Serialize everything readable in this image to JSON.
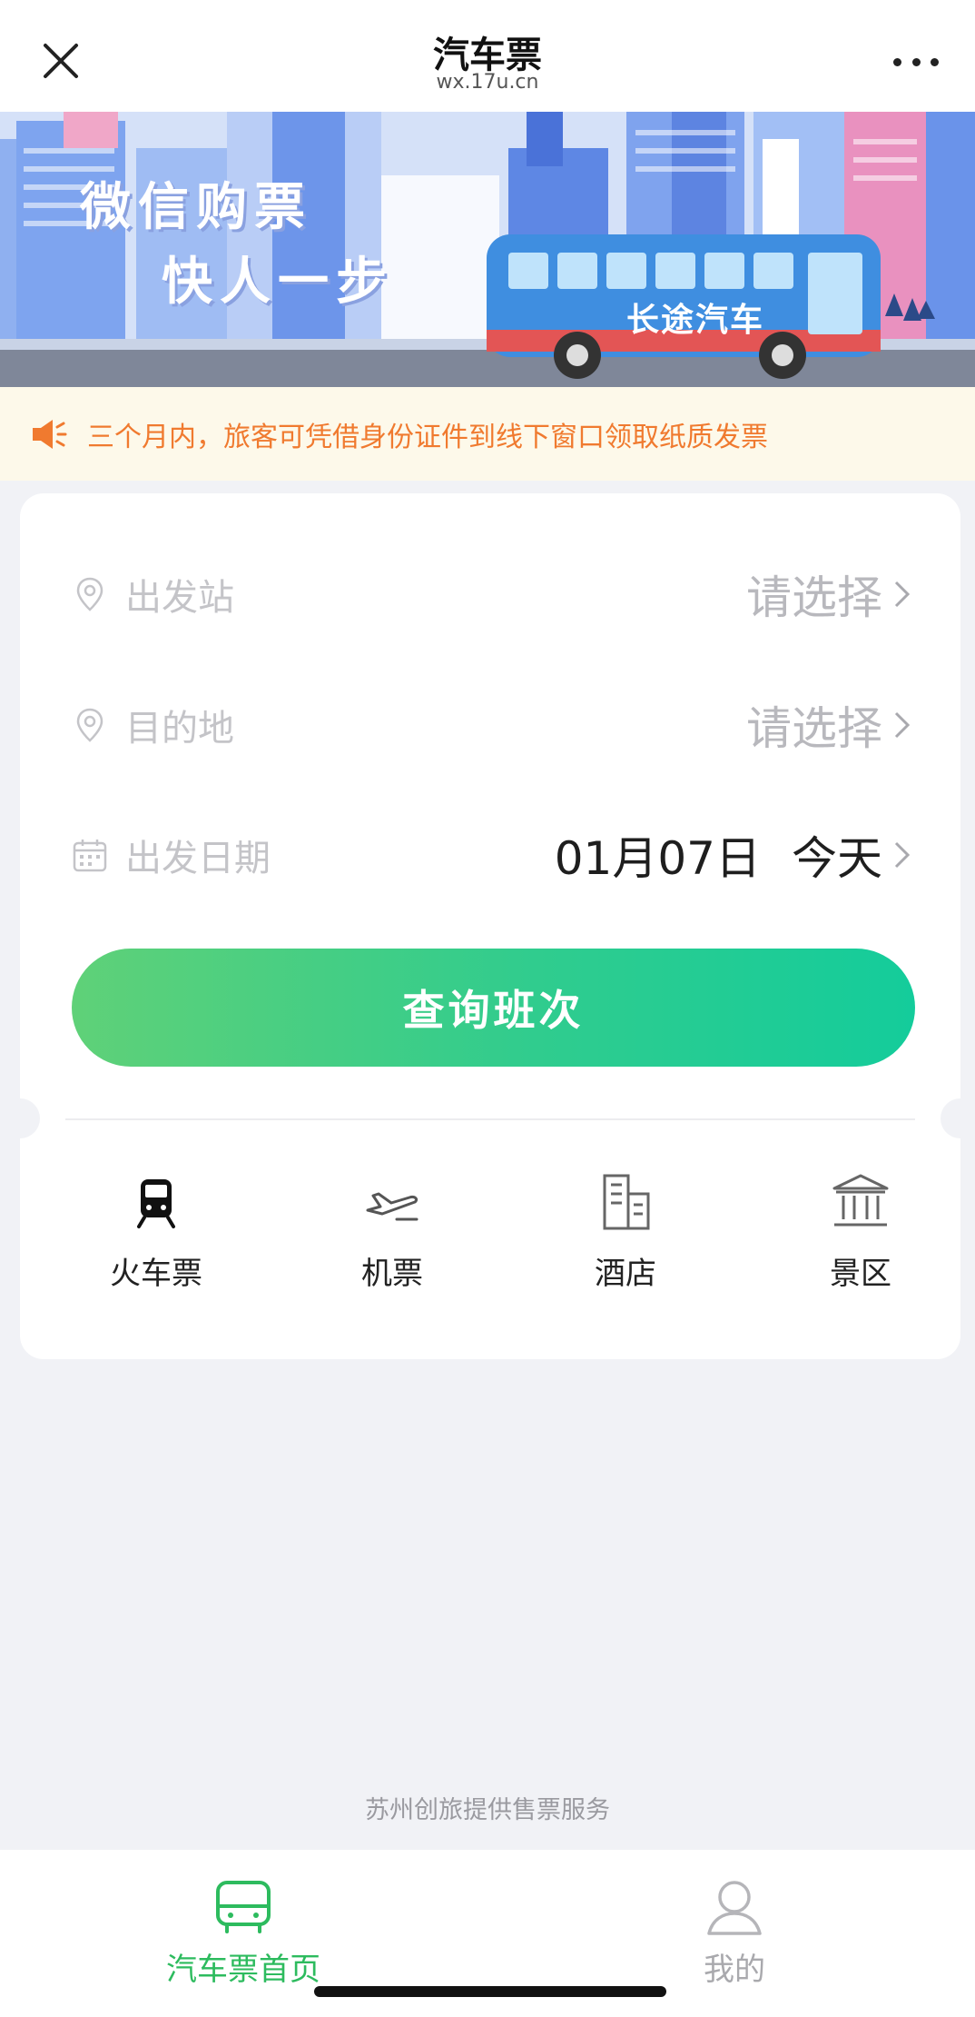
{
  "header": {
    "title": "汽车票",
    "url": "wx.17u.cn"
  },
  "banner": {
    "slogan_line1": "微信购票",
    "slogan_line2": "快人一步",
    "bus_sign": "长途汽车"
  },
  "notice": {
    "text": "三个月内，旅客可凭借身份证件到线下窗口领取纸质发票",
    "color": "#f07a2f"
  },
  "search": {
    "origin": {
      "label": "出发站",
      "value": "请选择",
      "icon": "location-pin-icon"
    },
    "destination": {
      "label": "目的地",
      "value": "请选择",
      "icon": "location-pin-icon"
    },
    "date": {
      "label": "出发日期",
      "value": "01月07日",
      "relative": "今天",
      "icon": "calendar-icon"
    },
    "query_button": "查询班次"
  },
  "services": [
    {
      "label": "火车票",
      "icon": "train-icon"
    },
    {
      "label": "机票",
      "icon": "airplane-icon"
    },
    {
      "label": "酒店",
      "icon": "hotel-icon"
    },
    {
      "label": "景区",
      "icon": "scenic-spot-icon"
    }
  ],
  "footer": {
    "provider": "苏州创旅提供售票服务"
  },
  "tabbar": {
    "home": {
      "label": "汽车票首页",
      "icon": "bus-icon",
      "active": true
    },
    "mine": {
      "label": "我的",
      "icon": "user-icon",
      "active": false
    }
  },
  "colors": {
    "accent": "#2dbb5e",
    "button_gradient_start": "#5fd178",
    "button_gradient_end": "#14cc9b",
    "notice_background": "#fdf9ea",
    "page_background": "#f1f2f6"
  }
}
